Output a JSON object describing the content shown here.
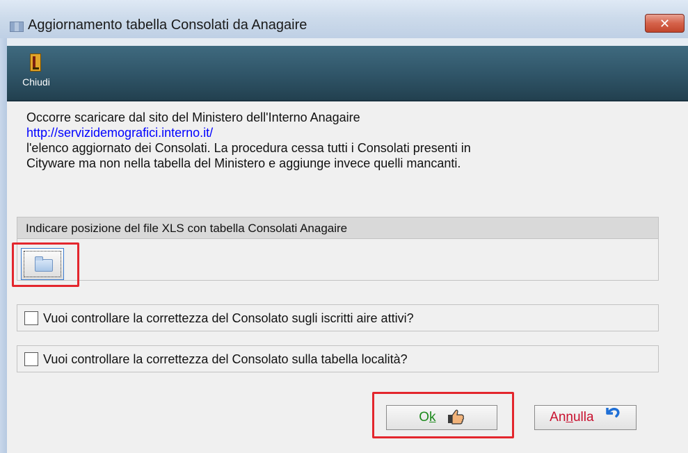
{
  "window": {
    "title": "Aggiornamento tabella Consolati da Anagaire",
    "close_label": "✕"
  },
  "toolbar": {
    "close_label": "Chiudi"
  },
  "description": {
    "line1": "Occorre scaricare dal sito del Ministero dell'Interno Anagaire",
    "link": "http://servizidemografici.interno.it/",
    "line3": "l'elenco aggiornato dei Consolati. La procedura cessa tutti i Consolati presenti in",
    "line4": "Cityware ma non nella tabella del Ministero e aggiunge invece quelli mancanti."
  },
  "file_section": {
    "label": "Indicare posizione del file XLS con tabella Consolati Anagaire",
    "path_value": ""
  },
  "options": [
    {
      "label": "Vuoi controllare la correttezza del Consolato sugli iscritti aire attivi?",
      "checked": false
    },
    {
      "label": "Vuoi controllare la correttezza del Consolato sulla tabella località?",
      "checked": false
    }
  ],
  "buttons": {
    "ok_pre": "O",
    "ok_ul": "k",
    "cancel_pre": "An",
    "cancel_ul": "n",
    "cancel_post": "ulla"
  },
  "icons": {
    "toolbar_close": "door-icon",
    "browse": "folder-icon",
    "ok": "thumbs-up-icon",
    "cancel": "undo-arrow-icon"
  },
  "colors": {
    "highlight": "#e3262d",
    "ok_text": "#1d8a1d",
    "cancel_text": "#c8102e",
    "link": "#0000ff",
    "toolbar": "#2f5467"
  }
}
